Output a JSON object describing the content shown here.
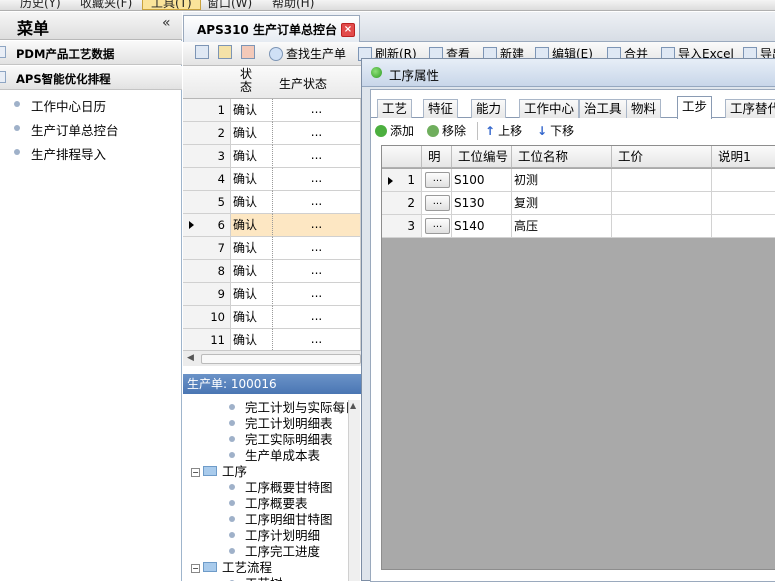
{
  "menubar": {
    "items": [
      "历史(Y)",
      "收藏夹(F)",
      "工具(T)",
      "窗口(W)",
      "帮助(H)"
    ]
  },
  "sidebar": {
    "title": "菜单",
    "collapse": "«",
    "groups": [
      {
        "label": "PDM产品工艺数据"
      },
      {
        "label": "APS智能优化排程",
        "items": [
          "工作中心日历",
          "生产订单总控台",
          "生产排程导入"
        ]
      }
    ]
  },
  "tabs": {
    "active": "APS310 生产订单总控台",
    "close": "×"
  },
  "toolbar": {
    "find": "查找生产单",
    "refresh": "刷新(R)",
    "view": "查看",
    "new": "新建",
    "edit": "编辑(E)",
    "merge": "合并",
    "import": "导入Excel",
    "export": "导出"
  },
  "grid": {
    "headers": [
      "状态",
      "生产状态"
    ],
    "selected_row": 6,
    "rows": [
      {
        "n": "1",
        "status": "确认",
        "prod": "..."
      },
      {
        "n": "2",
        "status": "确认",
        "prod": "..."
      },
      {
        "n": "3",
        "status": "确认",
        "prod": "..."
      },
      {
        "n": "4",
        "status": "确认",
        "prod": "..."
      },
      {
        "n": "5",
        "status": "确认",
        "prod": "..."
      },
      {
        "n": "6",
        "status": "确认",
        "prod": "..."
      },
      {
        "n": "7",
        "status": "确认",
        "prod": "..."
      },
      {
        "n": "8",
        "status": "确认",
        "prod": "..."
      },
      {
        "n": "9",
        "status": "确认",
        "prod": "..."
      },
      {
        "n": "10",
        "status": "确认",
        "prod": "..."
      },
      {
        "n": "11",
        "status": "确认",
        "prod": "..."
      }
    ]
  },
  "order": {
    "label": "生产单: 100016"
  },
  "tree": {
    "nodes": [
      {
        "text": "完工计划与实际每日",
        "type": "leaf"
      },
      {
        "text": "完工计划明细表",
        "type": "leaf"
      },
      {
        "text": "完工实际明细表",
        "type": "leaf"
      },
      {
        "text": "生产单成本表",
        "type": "leaf"
      },
      {
        "text": "工序",
        "type": "folder"
      },
      {
        "text": "工序概要甘特图",
        "type": "leaf"
      },
      {
        "text": "工序概要表",
        "type": "leaf"
      },
      {
        "text": "工序明细甘特图",
        "type": "leaf"
      },
      {
        "text": "工序计划明细",
        "type": "leaf"
      },
      {
        "text": "工序完工进度",
        "type": "leaf"
      },
      {
        "text": "工艺流程",
        "type": "folder"
      },
      {
        "text": "工艺树",
        "type": "leaf"
      }
    ]
  },
  "dialog": {
    "title": "工序属性",
    "tabs": [
      "工艺",
      "特征",
      "能力",
      "工作中心",
      "治工具",
      "物料",
      "工步",
      "工序替代"
    ],
    "active_tab": "工步",
    "toolbar": {
      "add": "添加",
      "remove": "移除",
      "up": "上移",
      "down": "下移"
    },
    "columns": [
      "明",
      "工位编号",
      "工位名称",
      "工价",
      "说明1"
    ],
    "rows": [
      {
        "n": "1",
        "btn": "...",
        "code": "S100",
        "name": "初测"
      },
      {
        "n": "2",
        "btn": "...",
        "code": "S130",
        "name": "复测"
      },
      {
        "n": "3",
        "btn": "...",
        "code": "S140",
        "name": "高压"
      }
    ]
  }
}
